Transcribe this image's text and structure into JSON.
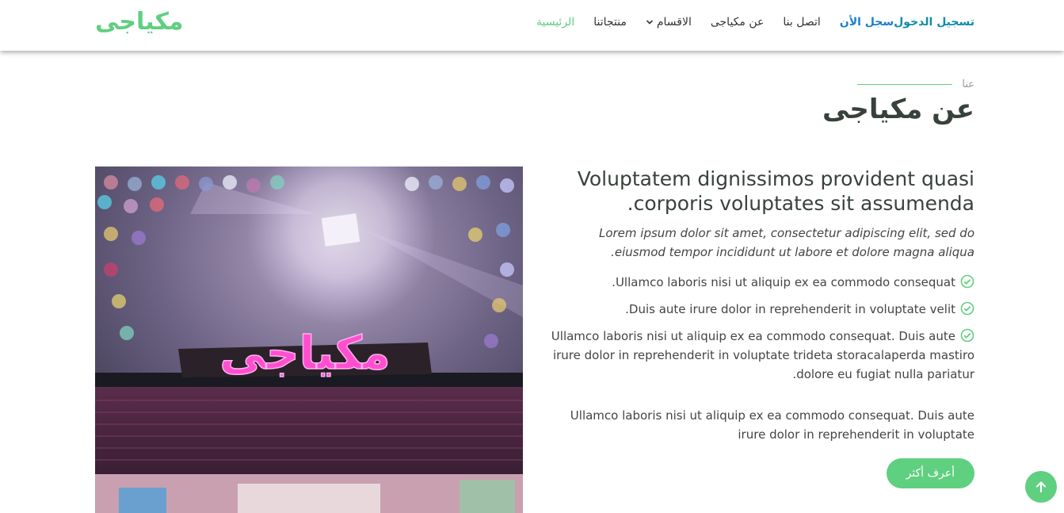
{
  "header": {
    "logo": "مكياجى",
    "nav": [
      {
        "label": "الرئيسية"
      },
      {
        "label": "منتجاتنا"
      },
      {
        "label": "الاقسام"
      },
      {
        "label": "عن مكياجى"
      },
      {
        "label": "اتصل بنا"
      },
      {
        "label": "سجل الأن"
      },
      {
        "label": "تسجيل الدخول"
      }
    ]
  },
  "about": {
    "subtitle": "عنا",
    "title": "عن مكياجى",
    "heading": "Voluptatem dignissimos provident quasi corporis voluptates sit assumenda.",
    "lead": "Lorem ipsum dolor sit amet, consectetur adipiscing elit, sed do eiusmod tempor incididunt ut labore et dolore magna aliqua.",
    "checks": [
      "Ullamco laboris nisi ut aliquip ex ea commodo consequat.",
      "Duis aute irure dolor in reprehenderit in voluptate velit.",
      "Ullamco laboris nisi ut aliquip ex ea commodo consequat. Duis aute irure dolor in reprehenderit in voluptate trideta storacalaperda mastiro dolore eu fugiat nulla pariatur."
    ],
    "paragraph": "Ullamco laboris nisi ut aliquip ex ea commodo consequat. Duis aute irure dolor in reprehenderit in voluptate",
    "button": "أعرف أكثر",
    "image_sign": "مكياجى"
  },
  "colors": {
    "accent": "#5fcf80",
    "blue": "#1c7fcc",
    "teal": "#0f8ca8",
    "heading": "#37423b"
  },
  "icons": {
    "check": "check-circle-icon",
    "chevron": "chevron-down-icon",
    "back_top": "arrow-up-icon"
  }
}
